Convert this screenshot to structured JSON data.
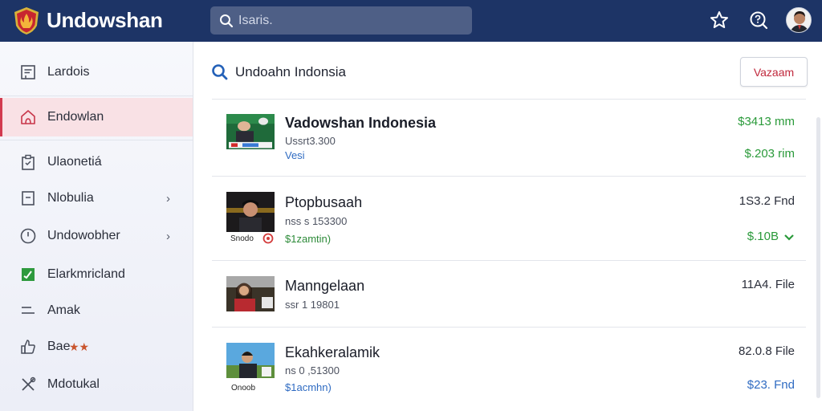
{
  "app": {
    "brand": "Undowshan",
    "search_placeholder": "Isaris."
  },
  "colors": {
    "topbar": "#1d3466",
    "accent_active": "#d23a4f",
    "positive": "#2a9a3a",
    "link": "#2f6bc2"
  },
  "sidebar": {
    "items": [
      {
        "label": "Lardois",
        "icon": "document-icon"
      },
      {
        "label": "Endowlan",
        "icon": "home-icon",
        "active": true
      },
      {
        "label": "Ulaonetiá",
        "icon": "clipboard-icon"
      },
      {
        "label": "Nlobulia",
        "icon": "box-icon",
        "chevron": "›"
      },
      {
        "label": "Undowobher",
        "icon": "clock-icon",
        "chevron": "›"
      },
      {
        "label": "Elarkmricland",
        "icon": "chart-icon"
      },
      {
        "label": "Amak",
        "icon": "menu-lines-icon"
      },
      {
        "label": "Bae",
        "icon": "thumb-icon",
        "stars": "★★"
      },
      {
        "label": "Mdotukal",
        "icon": "tools-icon"
      }
    ]
  },
  "main": {
    "title": "Undoahn Indonsia",
    "action_button": "Vazaam",
    "rows": [
      {
        "title": "Vadowshan Indonesia",
        "sub": "Ussrt3.300",
        "link": "Vesi",
        "right_top": "$3413 mm",
        "right_bottom": "$.203 rim",
        "badge": ""
      },
      {
        "title": "Ptopbusaah",
        "sub": "nss s 153300",
        "link": "$1zamtin)",
        "right_top": "1S3.2 Fnd",
        "right_bottom": "$.10B",
        "badge": "Snodo"
      },
      {
        "title": "Manngelaan",
        "sub": "ssr 1 19801",
        "link": "",
        "right_top": "11A4. File",
        "right_bottom": "",
        "badge": ""
      },
      {
        "title": "Ekahkeralamik",
        "sub": "ns 0 ,51300",
        "link": "$1acmhn)",
        "right_top": "82.0.8 File",
        "right_bottom": "$23. Fnd",
        "badge": "Onoob"
      }
    ]
  }
}
